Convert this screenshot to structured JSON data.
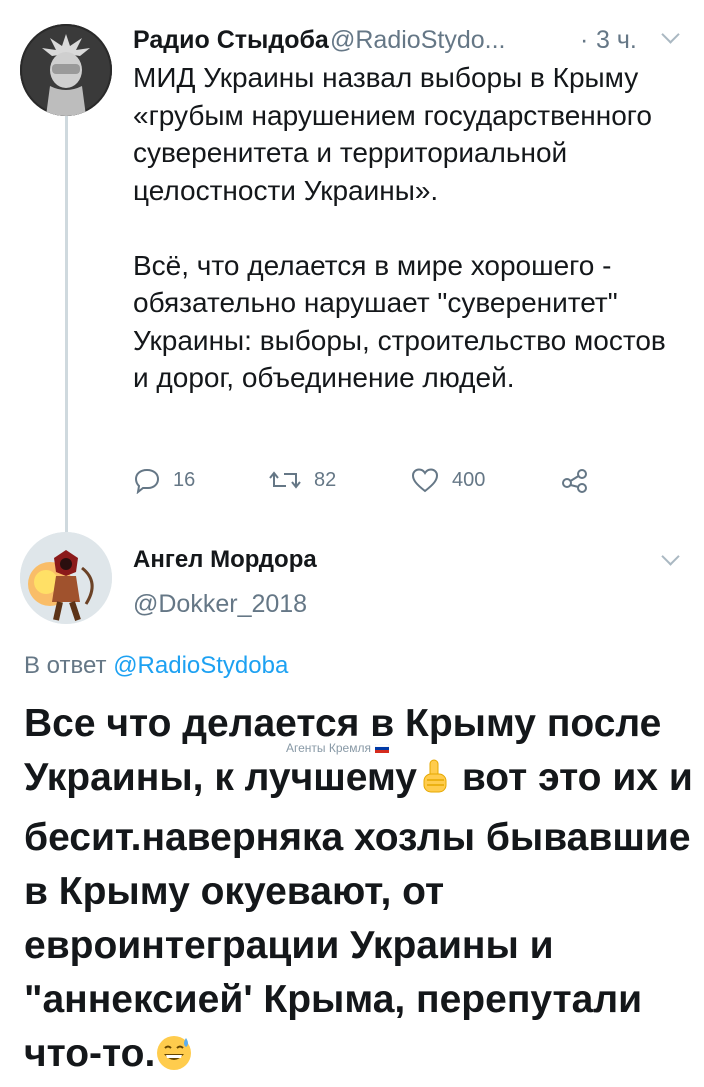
{
  "tweet1": {
    "author_name": "Радио Стыдоба",
    "handle": "@RadioStydo...",
    "separator": "·",
    "time": "3 ч.",
    "text_p1": "МИД Украины назвал выборы в Крыму «грубым нарушением государственного суверенитета и территориальной целостности Украины».",
    "text_p2": "Всё, что делается в мире хорошего - обязательно нарушает \"суверенитет\" Украины: выборы, строительство мостов и дорог, объединение людей.",
    "actions": {
      "replies": "16",
      "retweets": "82",
      "likes": "400"
    },
    "icons": [
      "reply-icon",
      "retweet-icon",
      "like-icon",
      "share-icon"
    ]
  },
  "tweet2": {
    "author_name": "Ангел Мордора",
    "handle": "@Dokker_2018",
    "reply_prefix": "В ответ",
    "reply_to": "@RadioStydoba",
    "text_a": "Все что делается в Крыму после Украины, к лучшему",
    "text_b": " вот это их и бесит.наверняка хозлы бывавшие в Крыму окуевают, от евроинтеграции Украины и \"аннексией' Крыма, перепутали что-то.",
    "emojis": [
      "pointing-up-emoji",
      "grinning-sweat-emoji"
    ]
  },
  "watermark": {
    "text": "Агенты Кремля"
  },
  "colors": {
    "text": "#14171a",
    "muted": "#657786",
    "link": "#1da1f2",
    "divider": "#cfd9de"
  }
}
